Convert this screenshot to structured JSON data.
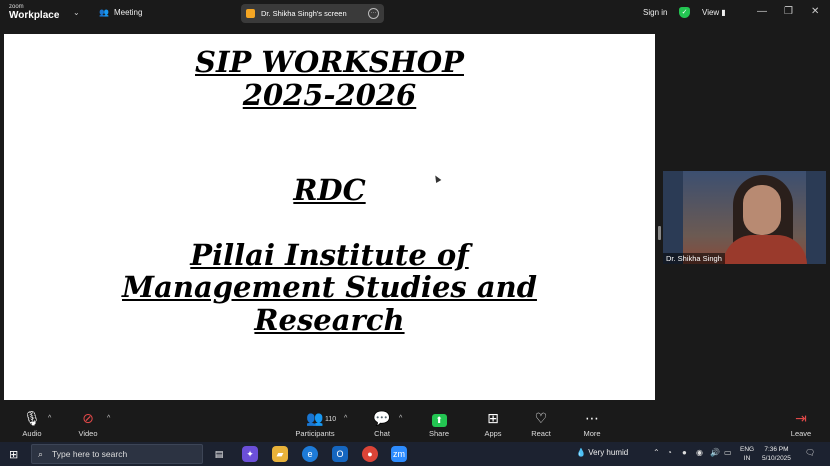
{
  "topbar": {
    "brand_small": "zoom",
    "brand_big": "Workplace",
    "meeting_label": "Meeting",
    "share_pill_label": "Dr. Shikha Singh's screen",
    "signin_label": "Sign in",
    "view_label": "View"
  },
  "slide": {
    "title_line1": "SIP WORKSHOP",
    "title_line2": "2025-2026",
    "line_rdc": "RDC",
    "inst_line1": "Pillai Institute of",
    "inst_line2": "Management Studies and",
    "inst_line3": "Research"
  },
  "video": {
    "participant_name": "Dr. Shikha Singh"
  },
  "toolbar": {
    "audio": "Audio",
    "video": "Video",
    "participants": "Participants",
    "participants_count": "110",
    "chat": "Chat",
    "share": "Share",
    "apps": "Apps",
    "react": "React",
    "more": "More",
    "leave": "Leave"
  },
  "taskbar": {
    "search_placeholder": "Type here to search",
    "weather": "Very humid",
    "lang_line1": "ENG",
    "lang_line2": "IN",
    "time": "7:36 PM",
    "date": "5/10/2025"
  },
  "colors": {
    "share_green": "#23c552",
    "window_bg": "#1a1a1a",
    "taskbar_bg": "#1c2230"
  }
}
